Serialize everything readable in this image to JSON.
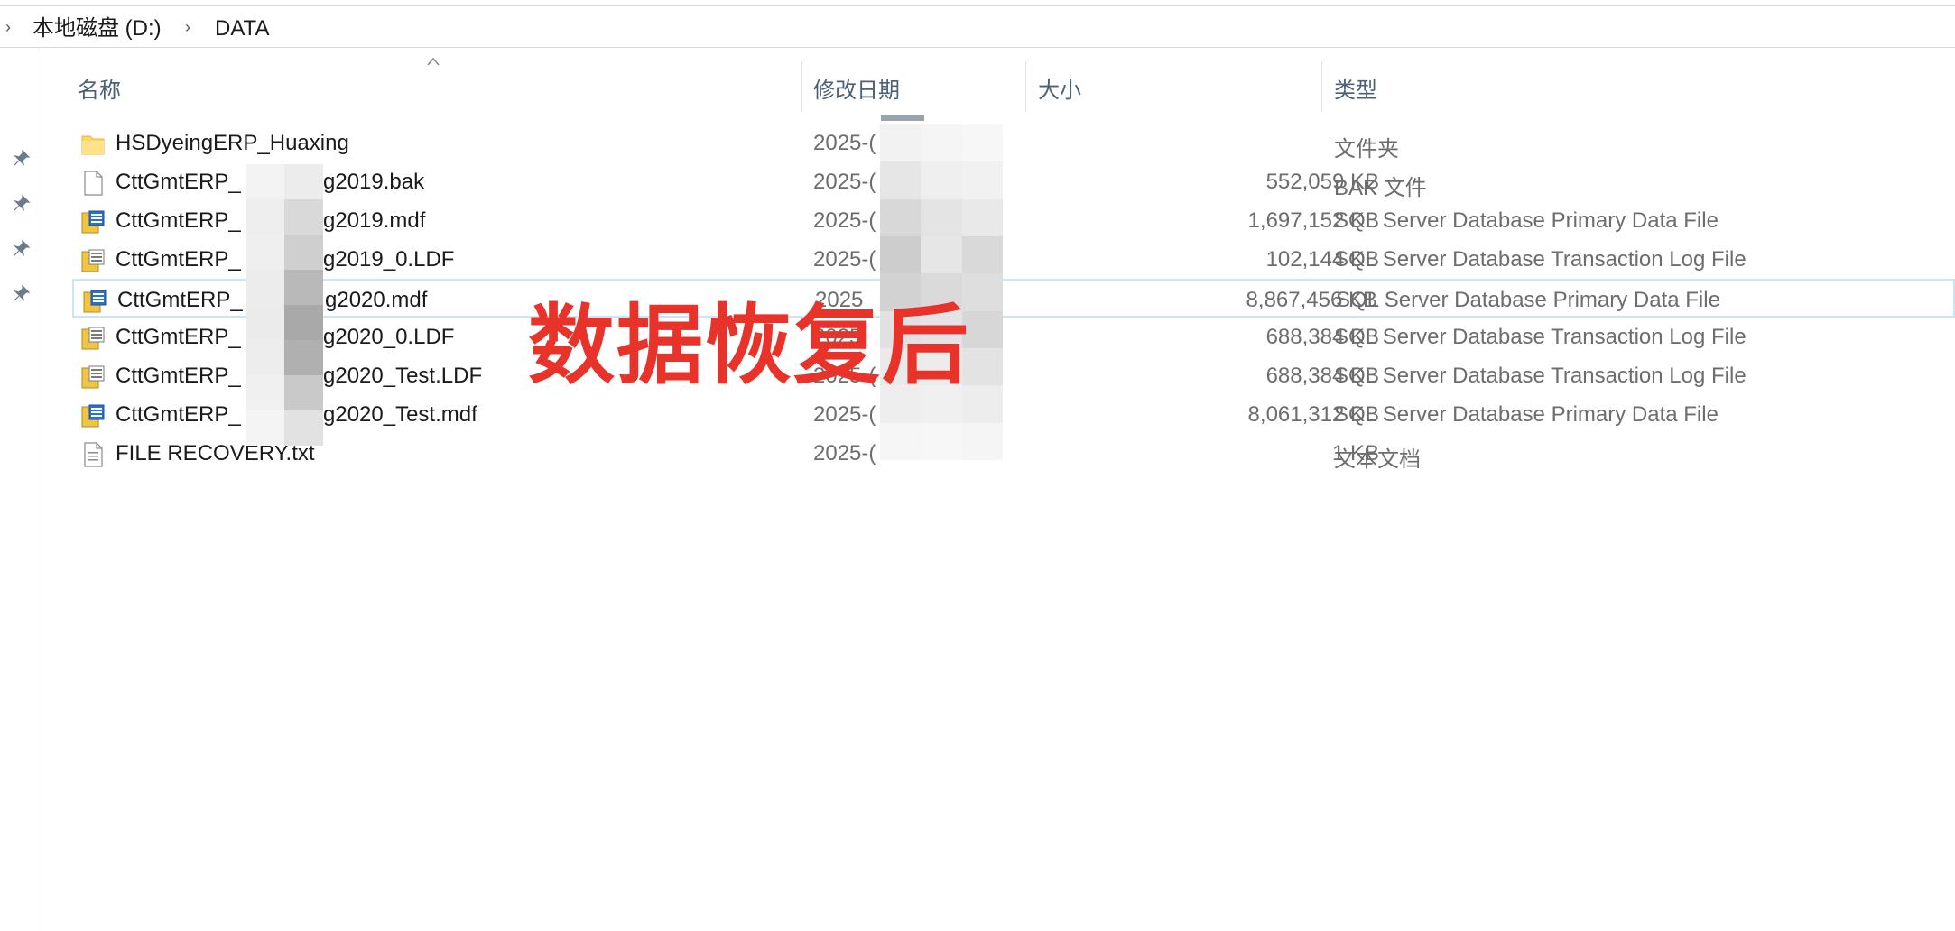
{
  "breadcrumb": {
    "items": [
      "本地磁盘 (D:)",
      "DATA"
    ]
  },
  "columns": {
    "name": "名称",
    "date": "修改日期",
    "size": "大小",
    "type": "类型"
  },
  "rows": [
    {
      "name": "HSDyeingERP_Huaxing",
      "date": "2025-(",
      "size": "",
      "type": "文件夹",
      "icon": "folder-icon"
    },
    {
      "name": "CttGmtERP_",
      "name_tail": "g2019.bak",
      "date": "2025-(",
      "size": "552,059 KB",
      "type": "BAK 文件",
      "icon": "file-icon"
    },
    {
      "name": "CttGmtERP_",
      "name_tail": "g2019.mdf",
      "date": "2025-(",
      "size": "1,697,152 KB",
      "type": "SQL Server Database Primary Data File",
      "icon": "database-file-icon"
    },
    {
      "name": "CttGmtERP_",
      "name_tail": "g2019_0.LDF",
      "date": "2025-(",
      "size": "102,144 KB",
      "type": "SQL Server Database Transaction Log File",
      "icon": "log-file-icon"
    },
    {
      "name": "CttGmtERP_",
      "name_tail": "g2020.mdf",
      "date": "2025",
      "size": "8,867,456 KB",
      "type": "SQL Server Database Primary Data File",
      "icon": "database-file-icon"
    },
    {
      "name": "CttGmtERP_",
      "name_tail": "g2020_0.LDF",
      "date": "2025",
      "size": "688,384 KB",
      "type": "SQL Server Database Transaction Log File",
      "icon": "log-file-icon"
    },
    {
      "name": "CttGmtERP_",
      "name_tail": "g2020_Test.LDF",
      "date": "2025-(",
      "size": "688,384 KB",
      "type": "SQL Server Database Transaction Log File",
      "icon": "log-file-icon"
    },
    {
      "name": "CttGmtERP_",
      "name_tail": "g2020_Test.mdf",
      "date": "2025-(",
      "size": "8,061,312 KB",
      "type": "SQL Server Database Primary Data File",
      "icon": "database-file-icon"
    },
    {
      "name": "FILE RECOVERY.txt",
      "date": "2025-(",
      "size": "1 KB",
      "type": "文本文档",
      "icon": "text-file-icon"
    }
  ],
  "overlay_text": "数据恢复后",
  "colors": {
    "overlay": "#e8332a",
    "header_text": "#4c607a",
    "selection_border": "#cce4f7",
    "folder": "#ffd766"
  }
}
